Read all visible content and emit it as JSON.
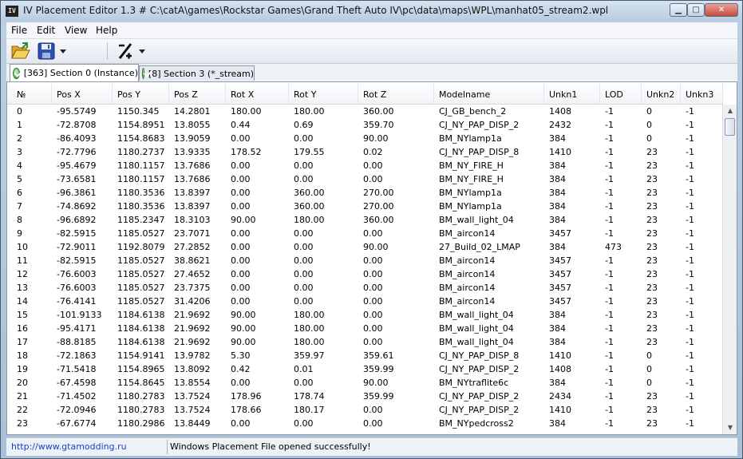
{
  "window": {
    "title": "IV Placement Editor 1.3 # C:\\catA\\games\\Rockstar Games\\Grand Theft Auto IV\\pc\\data\\maps\\WPL\\manhat05_stream2.wpl",
    "icon_text": "IV"
  },
  "menu": [
    "File",
    "Edit",
    "View",
    "Help"
  ],
  "toolbar": {
    "icons": [
      "open-folder-icon",
      "save-disk-icon",
      "dropdown-arrow-icon",
      "percent-tool-icon",
      "dropdown-arrow-icon"
    ]
  },
  "tabs": [
    {
      "label": "[363] Section 0 (Instance)",
      "active": true
    },
    {
      "label": "[8] Section 3 (*_stream)",
      "active": false
    }
  ],
  "table": {
    "columns": [
      "№",
      "Pos X",
      "Pos Y",
      "Pos Z",
      "Rot X",
      "Rot Y",
      "Rot Z",
      "Modelname",
      "Unkn1",
      "LOD",
      "Unkn2",
      "Unkn3"
    ],
    "rows": [
      [
        "0",
        "-95.5749",
        "1150.345",
        "14.2801",
        "180.00",
        "180.00",
        "360.00",
        "CJ_GB_bench_2",
        "1408",
        "-1",
        "0",
        "-1"
      ],
      [
        "1",
        "-72.8708",
        "1154.8951",
        "13.8055",
        "0.44",
        "0.69",
        "359.70",
        "CJ_NY_PAP_DISP_2",
        "2432",
        "-1",
        "0",
        "-1"
      ],
      [
        "2",
        "-86.4093",
        "1154.8683",
        "13.9059",
        "0.00",
        "0.00",
        "90.00",
        "BM_NYlamp1a",
        "384",
        "-1",
        "0",
        "-1"
      ],
      [
        "3",
        "-72.7796",
        "1180.2737",
        "13.9335",
        "178.52",
        "179.55",
        "0.02",
        "CJ_NY_PAP_DISP_8",
        "1410",
        "-1",
        "23",
        "-1"
      ],
      [
        "4",
        "-95.4679",
        "1180.1157",
        "13.7686",
        "0.00",
        "0.00",
        "0.00",
        "BM_NY_FIRE_H",
        "384",
        "-1",
        "23",
        "-1"
      ],
      [
        "5",
        "-73.6581",
        "1180.1157",
        "13.7686",
        "0.00",
        "0.00",
        "0.00",
        "BM_NY_FIRE_H",
        "384",
        "-1",
        "23",
        "-1"
      ],
      [
        "6",
        "-96.3861",
        "1180.3536",
        "13.8397",
        "0.00",
        "360.00",
        "270.00",
        "BM_NYlamp1a",
        "384",
        "-1",
        "23",
        "-1"
      ],
      [
        "7",
        "-74.8692",
        "1180.3536",
        "13.8397",
        "0.00",
        "360.00",
        "270.00",
        "BM_NYlamp1a",
        "384",
        "-1",
        "23",
        "-1"
      ],
      [
        "8",
        "-96.6892",
        "1185.2347",
        "18.3103",
        "90.00",
        "180.00",
        "360.00",
        "BM_wall_light_04",
        "384",
        "-1",
        "23",
        "-1"
      ],
      [
        "9",
        "-82.5915",
        "1185.0527",
        "23.7071",
        "0.00",
        "0.00",
        "0.00",
        "BM_aircon14",
        "3457",
        "-1",
        "23",
        "-1"
      ],
      [
        "10",
        "-72.9011",
        "1192.8079",
        "27.2852",
        "0.00",
        "0.00",
        "90.00",
        "27_Build_02_LMAP",
        "384",
        "473",
        "23",
        "-1"
      ],
      [
        "11",
        "-82.5915",
        "1185.0527",
        "38.8621",
        "0.00",
        "0.00",
        "0.00",
        "BM_aircon14",
        "3457",
        "-1",
        "23",
        "-1"
      ],
      [
        "12",
        "-76.6003",
        "1185.0527",
        "27.4652",
        "0.00",
        "0.00",
        "0.00",
        "BM_aircon14",
        "3457",
        "-1",
        "23",
        "-1"
      ],
      [
        "13",
        "-76.6003",
        "1185.0527",
        "23.7375",
        "0.00",
        "0.00",
        "0.00",
        "BM_aircon14",
        "3457",
        "-1",
        "23",
        "-1"
      ],
      [
        "14",
        "-76.4141",
        "1185.0527",
        "31.4206",
        "0.00",
        "0.00",
        "0.00",
        "BM_aircon14",
        "3457",
        "-1",
        "23",
        "-1"
      ],
      [
        "15",
        "-101.9133",
        "1184.6138",
        "21.9692",
        "90.00",
        "180.00",
        "0.00",
        "BM_wall_light_04",
        "384",
        "-1",
        "23",
        "-1"
      ],
      [
        "16",
        "-95.4171",
        "1184.6138",
        "21.9692",
        "90.00",
        "180.00",
        "0.00",
        "BM_wall_light_04",
        "384",
        "-1",
        "23",
        "-1"
      ],
      [
        "17",
        "-88.8185",
        "1184.6138",
        "21.9692",
        "90.00",
        "180.00",
        "0.00",
        "BM_wall_light_04",
        "384",
        "-1",
        "23",
        "-1"
      ],
      [
        "18",
        "-72.1863",
        "1154.9141",
        "13.9782",
        "5.30",
        "359.97",
        "359.61",
        "CJ_NY_PAP_DISP_8",
        "1410",
        "-1",
        "0",
        "-1"
      ],
      [
        "19",
        "-71.5418",
        "1154.8965",
        "13.8092",
        "0.42",
        "0.01",
        "359.99",
        "CJ_NY_PAP_DISP_2",
        "1408",
        "-1",
        "0",
        "-1"
      ],
      [
        "20",
        "-67.4598",
        "1154.8645",
        "13.8554",
        "0.00",
        "0.00",
        "90.00",
        "BM_NYtraflite6c",
        "384",
        "-1",
        "0",
        "-1"
      ],
      [
        "21",
        "-71.4502",
        "1180.2783",
        "13.7524",
        "178.96",
        "178.74",
        "359.99",
        "CJ_NY_PAP_DISP_2",
        "2434",
        "-1",
        "23",
        "-1"
      ],
      [
        "22",
        "-72.0946",
        "1180.2783",
        "13.7524",
        "178.66",
        "180.17",
        "0.00",
        "CJ_NY_PAP_DISP_2",
        "1410",
        "-1",
        "23",
        "-1"
      ],
      [
        "23",
        "-67.6774",
        "1180.2986",
        "13.8449",
        "0.00",
        "0.00",
        "0.00",
        "BM_NYpedcross2",
        "384",
        "-1",
        "23",
        "-1"
      ]
    ]
  },
  "status": {
    "link": "http://www.gtamodding.ru",
    "message": "Windows Placement File opened successfully!"
  }
}
